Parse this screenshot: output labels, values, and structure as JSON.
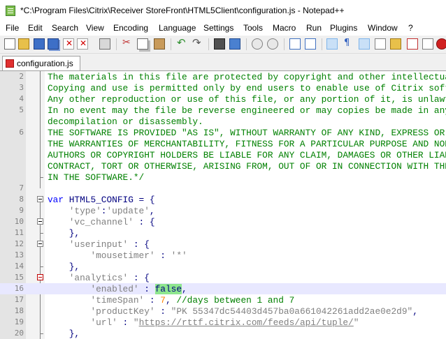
{
  "window": {
    "title": "*C:\\Program Files\\Citrix\\Receiver StoreFront\\HTML5Client\\configuration.js - Notepad++"
  },
  "menu": [
    "File",
    "Edit",
    "Search",
    "View",
    "Encoding",
    "Language",
    "Settings",
    "Tools",
    "Macro",
    "Run",
    "Plugins",
    "Window",
    "?"
  ],
  "toolbar": {
    "buttons": [
      "new-file-icon",
      "open-file-icon",
      "save-icon",
      "save-all-icon",
      "close-icon",
      "close-all-icon",
      "print-icon",
      "cut-icon",
      "copy-icon",
      "paste-icon",
      "undo-icon",
      "redo-icon",
      "find-icon",
      "replace-icon",
      "zoom-in-icon",
      "zoom-out-icon",
      "sync-vertical-icon",
      "sync-horizontal-icon",
      "word-wrap-icon",
      "show-all-chars-icon",
      "indent-guide-icon",
      "function-list-icon",
      "doc-map-icon",
      "folder-workspace-icon",
      "monitoring-icon",
      "record-macro-icon",
      "stop-record-icon"
    ]
  },
  "tab": {
    "label": "configuration.js"
  },
  "editor": {
    "lines": [
      {
        "no": "2",
        "text": "The materials in this file are protected by copyright and other intellectual"
      },
      {
        "no": "3",
        "text": "Copying and use is permitted only by end users to enable use of Citrix softwa"
      },
      {
        "no": "4",
        "text": "Any other reproduction or use of this file, or any portion of it, is unlawful"
      },
      {
        "no": "5",
        "text": "In no event may the file be reverse engineered or may copies be made in any fo"
      },
      {
        "no": "",
        "text": "decompilation or disassembly."
      },
      {
        "no": "6",
        "text": "THE SOFTWARE IS PROVIDED \"AS IS\", WITHOUT WARRANTY OF ANY KIND, EXPRESS OR IM"
      },
      {
        "no": "",
        "text": "THE WARRANTIES OF MERCHANTABILITY, FITNESS FOR A PARTICULAR PURPOSE AND NONINFR"
      },
      {
        "no": "",
        "text": "AUTHORS OR COPYRIGHT HOLDERS BE LIABLE FOR ANY CLAIM, DAMAGES OR OTHER LIABILIT"
      },
      {
        "no": "",
        "text": "CONTRACT, TORT OR OTHERWISE, ARISING FROM, OUT OF OR IN CONNECTION WITH THE SO"
      },
      {
        "no": "",
        "text": "IN THE SOFTWARE.*/"
      },
      {
        "no": "7",
        "text": ""
      },
      {
        "no": "8",
        "kw": "var",
        "text": " HTML5_CONFIG = {"
      },
      {
        "no": "9",
        "indent": "    ",
        "key": "'type'",
        "sep": ":",
        "val": "'update'",
        "tail": ","
      },
      {
        "no": "10",
        "indent": "    ",
        "key": "'vc_channel'",
        "sep": " : {"
      },
      {
        "no": "11",
        "indent": "    ",
        "sep": "},"
      },
      {
        "no": "12",
        "indent": "    ",
        "key": "'userinput'",
        "sep": " : {"
      },
      {
        "no": "13",
        "indent": "        ",
        "key": "'mousetimer'",
        "sep": " : ",
        "val": "'*'"
      },
      {
        "no": "14",
        "indent": "    ",
        "sep": "},"
      },
      {
        "no": "15",
        "indent": "    ",
        "key": "'analytics'",
        "sep": " : {"
      },
      {
        "no": "16",
        "indent": "        ",
        "key": "'enabled'",
        "sep": " : ",
        "hl": "false",
        "tail": ","
      },
      {
        "no": "17",
        "indent": "        ",
        "key": "'timeSpan'",
        "sep": " : ",
        "num": "7",
        "tail": ", ",
        "lc": "//days between 1 and 7"
      },
      {
        "no": "18",
        "indent": "        ",
        "key": "'productKey'",
        "sep": " : ",
        "val": "\"PK 55347dc54403d457ba0a661042261add2ae0e2d9\"",
        "tail": ","
      },
      {
        "no": "19",
        "indent": "        ",
        "key": "'url'",
        "sep": " : ",
        "q1": "\"",
        "url": "https://rttf.citrix.com/feeds/api/tuple/",
        "q2": "\""
      },
      {
        "no": "20",
        "indent": "    ",
        "sep": "},"
      }
    ]
  },
  "colors": {
    "comment": "#008000",
    "keyword": "#0000ff",
    "string": "#808080",
    "number": "#ff8000",
    "current_line": "#e8e8ff",
    "highlight": "#8ee68e"
  }
}
